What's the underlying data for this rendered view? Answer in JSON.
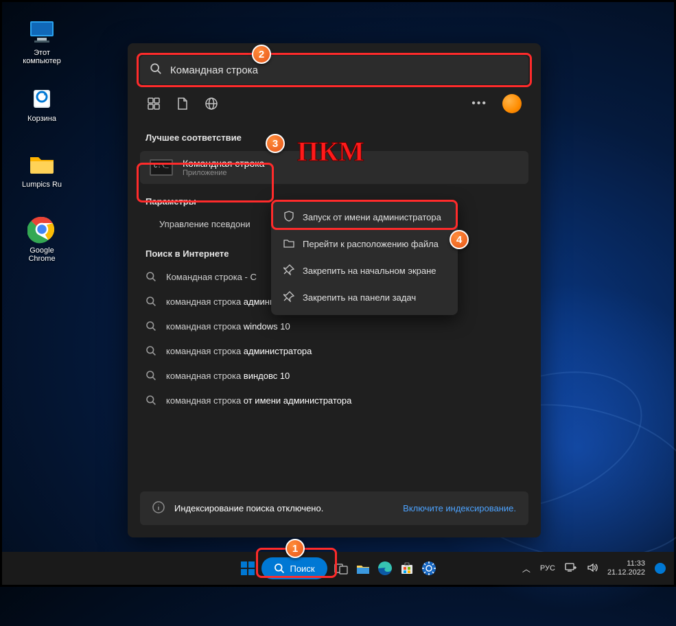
{
  "desktop": {
    "this_pc": "Этот\nкомпьютер",
    "recycle": "Корзина",
    "folder": "Lumpics Ru",
    "chrome": "Google\nChrome"
  },
  "search": {
    "query": "Командная строка",
    "best_match_header": "Лучшее соответствие",
    "best_match_title": "Командная строка",
    "best_match_subtitle": "Приложение",
    "params_header": "Параметры",
    "params_item": "Управление псевдони",
    "web_header": "Поиск в Интернете",
    "web_items": [
      {
        "plain": "Командная строка - С",
        "bold": ""
      },
      {
        "plain": "командная строка ",
        "bold": "администратор"
      },
      {
        "plain": "командная строка ",
        "bold": "windows 10"
      },
      {
        "plain": "командная строка ",
        "bold": "администратора"
      },
      {
        "plain": "командная строка ",
        "bold": "виндовс 10"
      },
      {
        "plain": "командная строка ",
        "bold": "от имени администратора"
      }
    ],
    "index_disabled": "Индексирование поиска отключено.",
    "index_link": "Включите индексирование."
  },
  "context_menu": {
    "run_admin": "Запуск от имени администратора",
    "open_location": "Перейти к расположению файла",
    "pin_start": "Закрепить на начальном экране",
    "pin_taskbar": "Закрепить на панели задач"
  },
  "taskbar": {
    "search_label": "Поиск",
    "lang": "РУС",
    "time": "11:33",
    "date": "21.12.2022"
  },
  "annotations": {
    "pkm": "ПКМ",
    "b1": "1",
    "b2": "2",
    "b3": "3",
    "b4": "4"
  }
}
